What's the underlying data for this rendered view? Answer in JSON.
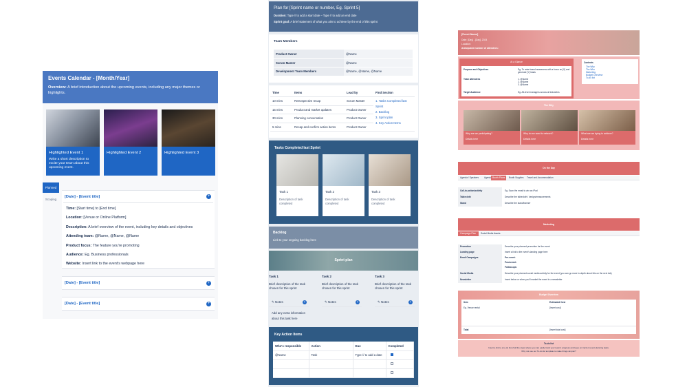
{
  "left": {
    "title": "Events Calendar - [Month/Year]",
    "overview_label": "Overview:",
    "overview_text": " A brief introduction about the upcoming events, including any major themes or highlights.",
    "highlights": [
      {
        "title": "Highlighted Event 1",
        "desc": "Write a short description to excite your team about this upcoming event."
      },
      {
        "title": "Highlighted Event 2",
        "desc": ""
      },
      {
        "title": "Highlighted Event 3",
        "desc": ""
      }
    ],
    "tabs": [
      "Planned",
      "Scoping"
    ],
    "accordion_title": "[Date] - [Event title]",
    "details": [
      {
        "label": "Time:",
        "value": " [Start time] to [End time]"
      },
      {
        "label": "Location:",
        "value": " [Venue or Online Platform]"
      },
      {
        "label": "Description:",
        "value": " A brief overview of the event, including key details and objectives"
      },
      {
        "label": "Attending team:",
        "value": " @Name, @Name, @Name"
      },
      {
        "label": "Product focus:",
        "value": " The feature you're promoting"
      },
      {
        "label": "Audience:",
        "value": " Eg. Business professionals"
      },
      {
        "label": "Website:",
        "value": " Insert link to the event's webpage here"
      }
    ],
    "collapsed": [
      "[Date] - [Event title]",
      "[Date] - [Event title]"
    ]
  },
  "middle": {
    "title": "Plan for [Sprint name or number, Eg. Sprint 5]",
    "duration_label": "Duration:",
    "duration_text": " Type // to add a start date – Type // to add an end date",
    "goal_label": "Sprint goal:",
    "goal_text": " A brief statement of what you aim to achieve by the end of this sprint",
    "team_heading": "Team Members",
    "team": [
      {
        "role": "Product Owner",
        "name": "@Name"
      },
      {
        "role": "Scrum Master",
        "name": "@Name"
      },
      {
        "role": "Development Team Members",
        "name": "@Name, @Name, @Name"
      }
    ],
    "agenda_headers": [
      "Time",
      "Items",
      "Lead by",
      "Find Section"
    ],
    "agenda": [
      {
        "time": "10 mins",
        "item": "Retrospective recap",
        "lead": "Scrum Master"
      },
      {
        "time": "15 mins",
        "item": "Product and market updates",
        "lead": "Product Owner"
      },
      {
        "time": "30 mins",
        "item": "Planning conversation",
        "lead": "Product Owner"
      },
      {
        "time": "5 mins",
        "item": "Recap and confirm action items",
        "lead": "Product Owner"
      }
    ],
    "find_sections": [
      "1. Tasks Completed last Sprint",
      "2. Backlog",
      "3. Sprint plan",
      "4. Key Action Items"
    ],
    "completed_title": "Tasks Completed last Sprint",
    "completed_tasks": [
      {
        "title": "Task 1",
        "desc": "Description of task completed"
      },
      {
        "title": "Task 2",
        "desc": "Description of task completed"
      },
      {
        "title": "Task 3",
        "desc": "Description of task completed"
      }
    ],
    "backlog_title": "Backlog",
    "backlog_desc": "Link to your ongoing backlog here",
    "sprint_plan_title": "Sprint plan",
    "plan_tasks": [
      {
        "title": "Task 1",
        "desc": "Brief description of the task chosen for this sprint"
      },
      {
        "title": "Task 2",
        "desc": "Brief description of the task chosen for this sprint"
      },
      {
        "title": "Task 3",
        "desc": "Brief description of the task chosen for this sprint"
      }
    ],
    "notes_label": "Notes",
    "notes_text": "Add any extra information about this task here",
    "kai_title": "Key Action Items",
    "kai_headers": [
      "Who's responsible",
      "Action",
      "Due",
      "Completed"
    ],
    "kai_rows": [
      {
        "who": "@Name",
        "action": "Task",
        "due": "Type // to add a date",
        "done": true
      },
      {
        "who": "",
        "action": "",
        "due": "",
        "done": false
      },
      {
        "who": "",
        "action": "",
        "due": "",
        "done": false
      }
    ]
  },
  "right": {
    "hero_title": "[Event Name]",
    "hero_lines": [
      "Date: [Day] - [Day], 2024",
      "Location:",
      "Anticipated number of attendees:"
    ],
    "at_a_glance": "At a Glance",
    "glance_rows": [
      {
        "k": "Purpose and Objectives",
        "v": "Eg. To raise brand awareness with a focus on [X] and generate [Y] leads"
      },
      {
        "k": "Team Attendees",
        "v": "1. @Name\n2. @Name\n3. @Name"
      },
      {
        "k": "Target Audience",
        "v": "Eg. All-level managers across all industries"
      }
    ],
    "contents_title": "Contents",
    "contents": [
      "The Why",
      "The Who",
      "Marketing",
      "Budget Overview",
      "To-do list"
    ],
    "the_why": "The Why",
    "why_cards": [
      "Why are we participating?",
      "Why do we want to network?",
      "What are we trying to achieve?",
      "What are we trying to achieve?"
    ],
    "why_desc": "Details here",
    "on_the_day": "On the Day",
    "day_tabs": [
      "Agenda / Speakers",
      "Agenda",
      "Booth Plans",
      "Booth Supplies",
      "Travel and Accommodation"
    ],
    "day_rows": [
      {
        "k": "Call-to-action/activity",
        "v": "Eg. Scan the email to win an iPad"
      },
      {
        "k": "Tablecloth",
        "v": "Describe the tablecloth / design/measurements"
      },
      {
        "k": "Stand",
        "v": "Describe the stand/banner"
      }
    ],
    "marketing": "Marketing",
    "mk_tabs": [
      "Campaign Plan",
      "Social Media Assets"
    ],
    "mk_rows": [
      {
        "k": "Promotion",
        "v": "Describe your planned promotion for the event"
      },
      {
        "k": "Landing page",
        "v": "Insert a link to the event's landing page here"
      },
      {
        "k": "Email Campaigns",
        "v": "Pre-event:"
      },
      {
        "k": "",
        "v": "Post-event:"
      },
      {
        "k": "",
        "v": "Follow ups:"
      },
      {
        "k": "Social Media",
        "v": "Describe your planned social media activity for the event (you can go more in-depth about this on the next tab)"
      },
      {
        "k": "Newsletter",
        "v": "Insert below or when you'll market the event in a newsletter"
      }
    ],
    "budget": "Budget Overview",
    "budget_headers": [
      "Item",
      "Estimated Cost"
    ],
    "budget_rows": [
      {
        "k": "Eg. Venue rental",
        "v": "[Insert cost]"
      }
    ],
    "budget_total": {
      "k": "Total",
      "v": "[Insert total cost]"
    },
    "todo_title": "To-do list",
    "todo_text": "Insert a link to a to-do list of all the steps where you can easily track your team's progress and keep on track of event planning tasks.",
    "todo_text2": "Why not use our To-do list template to make things simpler?"
  }
}
